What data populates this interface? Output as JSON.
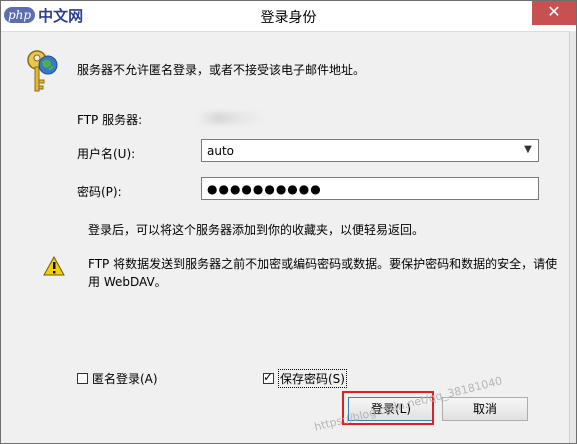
{
  "watermark_logo": {
    "php": "php",
    "text": "中文网"
  },
  "window": {
    "title": "登录身份",
    "close_glyph": "✕"
  },
  "message": "服务器不允许匿名登录，或者不接受该电子邮件地址。",
  "ftp_server_label": "FTP 服务器:",
  "username": {
    "label": "用户名(U):",
    "value": "auto"
  },
  "password": {
    "label": "密码(P):",
    "value": "●●●●●●●●●●"
  },
  "info_text": "登录后，可以将这个服务器添加到你的收藏夹，以便轻易返回。",
  "warning_text": "FTP 将数据发送到服务器之前不加密或编码密码或数据。要保护密码和数据的安全，请使用 WebDAV。",
  "checkboxes": {
    "anonymous": {
      "label": "匿名登录(A)",
      "checked": false
    },
    "save_password": {
      "label": "保存密码(S)",
      "checked": true
    }
  },
  "buttons": {
    "login": "登录(L)",
    "cancel": "取消"
  },
  "watermark_text": "https://blog.csdn.net/qq_38181040",
  "colors": {
    "highlight": "#e02020",
    "close": "#c75050",
    "focus": "#3c7fb1"
  }
}
